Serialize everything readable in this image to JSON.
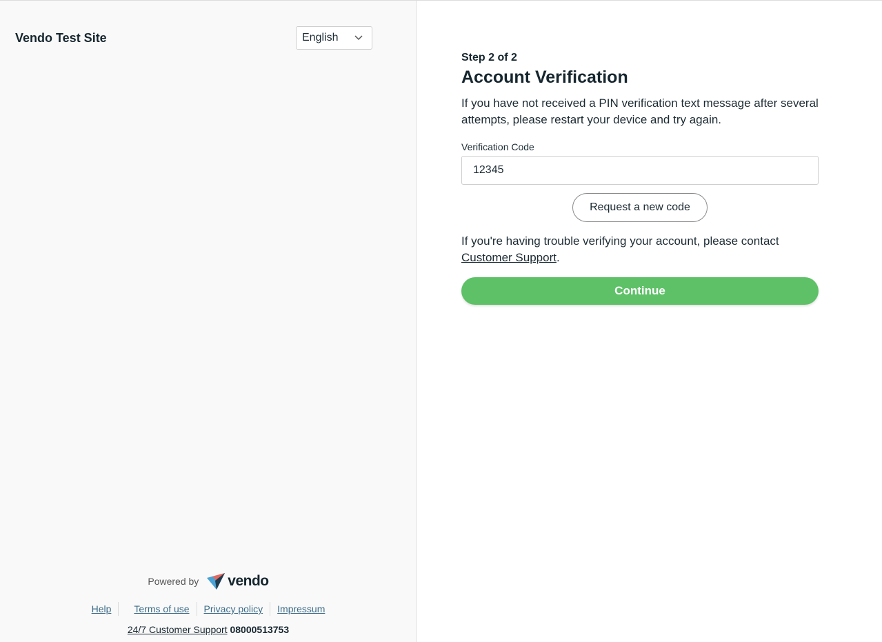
{
  "sidebar": {
    "site_title": "Vendo Test Site",
    "language": {
      "selected": "English"
    },
    "powered_by": "Powered by",
    "brand_word": "vendo",
    "footer_links": {
      "help": "Help",
      "terms": "Terms of use",
      "privacy": "Privacy policy",
      "impressum": "Impressum"
    },
    "support": {
      "label": "24/7 Customer Support",
      "phone": "08000513753"
    }
  },
  "main": {
    "step": "Step 2 of 2",
    "title": "Account Verification",
    "intro": "If you have not received a PIN verification text message after several attempts, please restart your device and try again.",
    "code_label": "Verification Code",
    "code_value": "12345",
    "request_button": "Request a new code",
    "trouble_text": "If you're having trouble verifying your account, please contact ",
    "support_link": "Customer Support",
    "trouble_end": ".",
    "continue_button": "Continue"
  },
  "colors": {
    "primary_green": "#5ec168",
    "text_dark": "#16262e",
    "link_blue": "#3b6b86",
    "sidebar_bg": "#f9f9f9"
  }
}
